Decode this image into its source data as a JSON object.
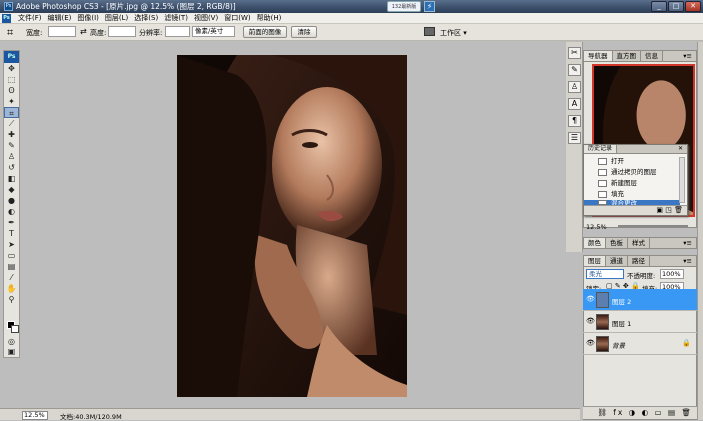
{
  "titlebar": {
    "title": "Adobe Photoshop CS3 - [原片.jpg @ 12.5% (图层 2, RGB/8)]",
    "chip": "132最新版",
    "min": "_",
    "max": "□",
    "close": "✕"
  },
  "menu": [
    "文件(F)",
    "编辑(E)",
    "图像(I)",
    "图层(L)",
    "选择(S)",
    "滤镜(T)",
    "视图(V)",
    "窗口(W)",
    "帮助(H)"
  ],
  "options": {
    "width_label": "宽度:",
    "height_label": "高度:",
    "resolution_label": "分辨率:",
    "unit_value": "像素/英寸",
    "front_image_button": "前面的图像",
    "clear_button": "清除",
    "workspace_label": "工作区 ▾"
  },
  "navigator": {
    "tabs": [
      "导航器",
      "直方图",
      "信息"
    ],
    "zoom": "12.5%"
  },
  "history": {
    "title": "历史记录",
    "items": [
      {
        "label": "打开",
        "selected": false
      },
      {
        "label": "通过拷贝的图层",
        "selected": false
      },
      {
        "label": "新建图层",
        "selected": false
      },
      {
        "label": "填充",
        "selected": false
      },
      {
        "label": "混合更改",
        "selected": true
      }
    ]
  },
  "color_panel": {
    "tabs": [
      "颜色",
      "色板",
      "样式"
    ]
  },
  "layers": {
    "tabs": [
      "图层",
      "通道",
      "路径"
    ],
    "blend_mode": "柔光",
    "opacity_label": "不透明度:",
    "opacity": "100%",
    "lock_label": "锁定:",
    "fill_label": "填充:",
    "fill": "100%",
    "items": [
      {
        "name": "图层 2",
        "selected": true,
        "locked": false
      },
      {
        "name": "图层 1",
        "selected": false,
        "locked": false
      },
      {
        "name": "背景",
        "selected": false,
        "locked": true
      }
    ],
    "footer_icons": "⛓ fx ◑ ◐ ▭ ▤ 🗑"
  },
  "status": {
    "zoom": "12.5%",
    "doc": "文档:40.3M/120.9M"
  },
  "colors": {
    "accent": "#3a98f5",
    "canvas_bg": "#bdbdbd",
    "selected_history": "#3976c4"
  }
}
